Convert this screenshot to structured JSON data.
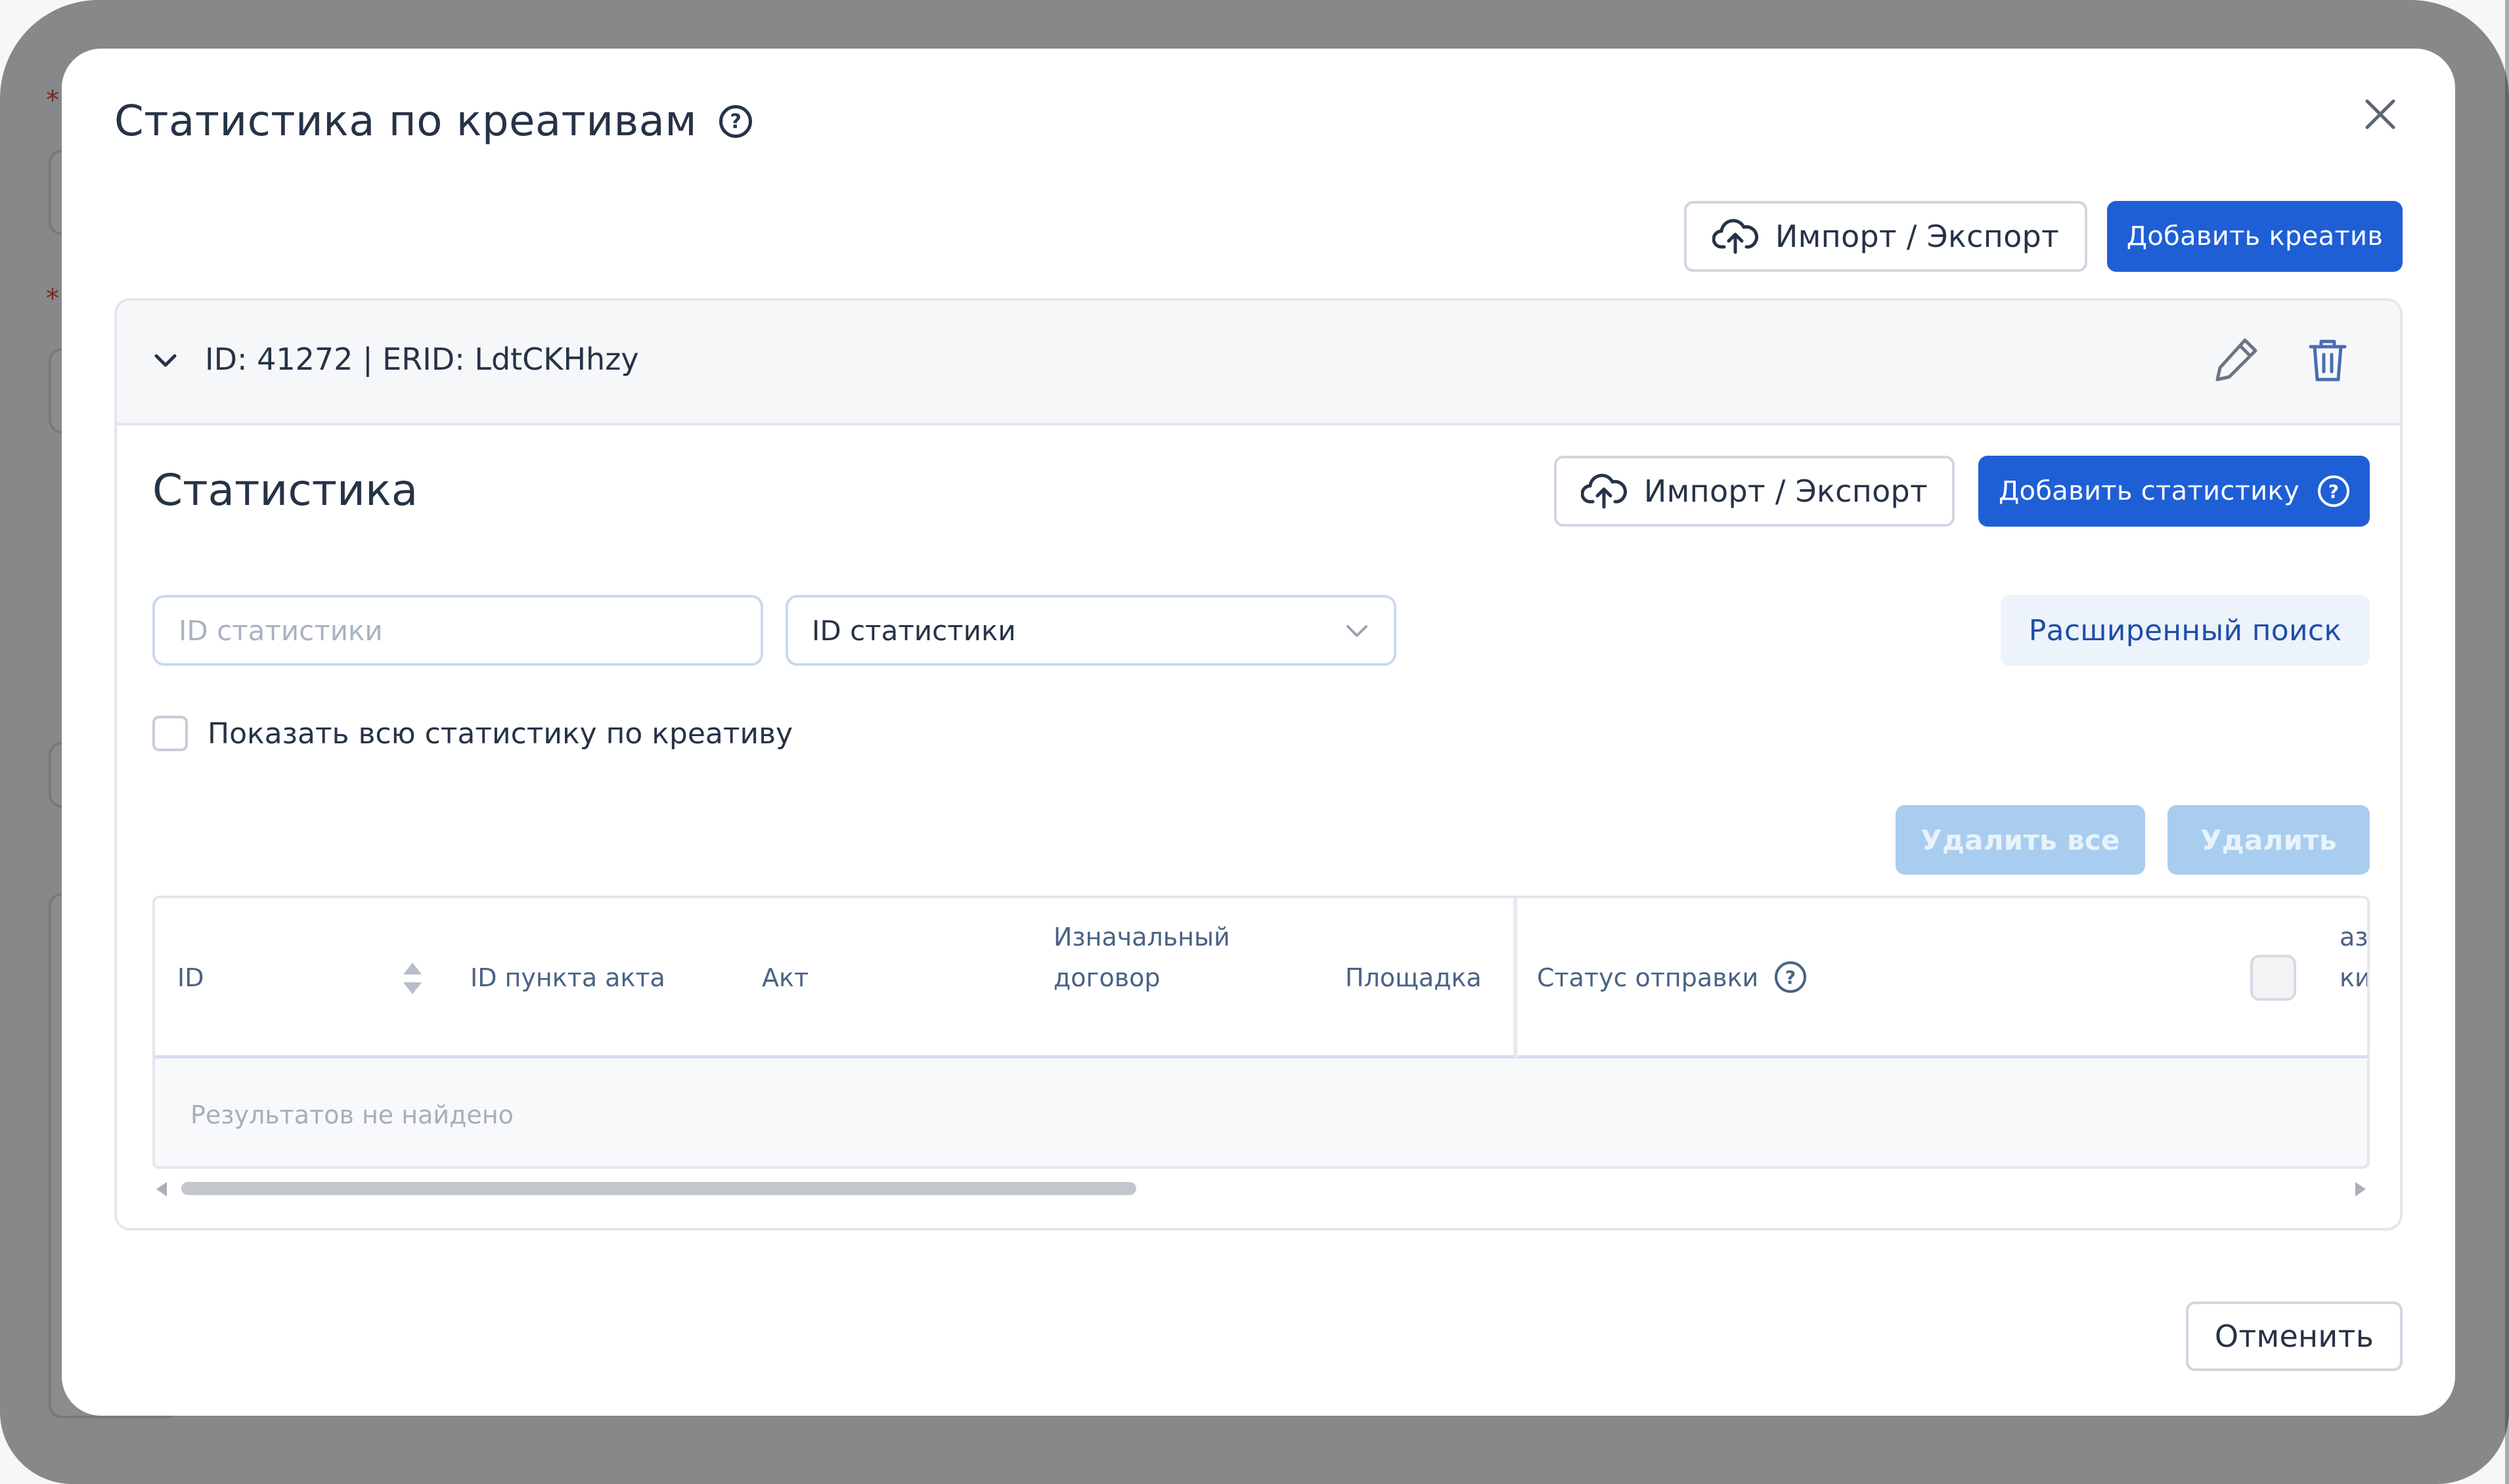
{
  "modal": {
    "title": "Статистика по креативам",
    "help_icon": "question-circle-icon",
    "close_icon": "close-icon",
    "import_export_label": "Импорт / Экспорт",
    "add_creative_label": "Добавить креатив",
    "cancel_label": "Отменить"
  },
  "creative": {
    "title": "ID: 41272 | ERID: LdtCKHhzy",
    "expand_icon": "chevron-down-icon",
    "edit_icon": "pencil-icon",
    "delete_icon": "trash-icon"
  },
  "statistics": {
    "title": "Статистика",
    "import_export_label": "Импорт / Экспорт",
    "add_label": "Добавить статистику",
    "search_placeholder": "ID статистики",
    "filter_value": "ID статистики",
    "advanced_search_label": "Расширенный поиск",
    "show_all_label": "Показать всю статистику по креативу",
    "show_all_checked": false,
    "delete_all_label": "Удалить все",
    "delete_label": "Удалить"
  },
  "table": {
    "columns": [
      "ID",
      "ID пункта акта",
      "Акт",
      "Изначальный",
      "договор",
      "Площадка",
      "Статус отправки",
      "аз",
      "ки"
    ],
    "empty_text": "Результатов не найдено"
  },
  "colors": {
    "primary": "#1f5fd6",
    "disabled": "#a9cdef",
    "text": "#263347",
    "overlay": "rgba(0,0,0,0.45)"
  }
}
